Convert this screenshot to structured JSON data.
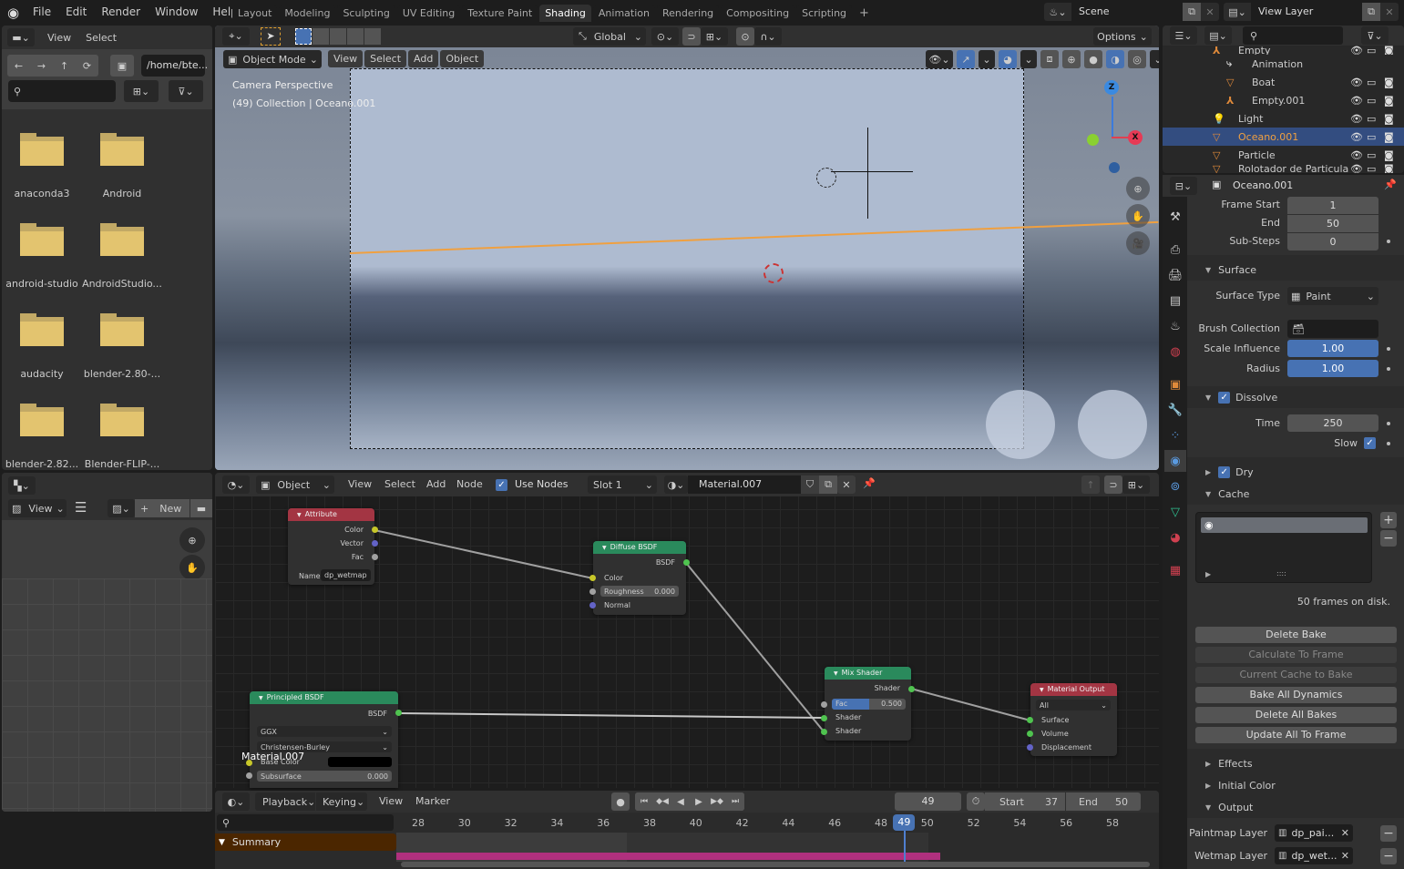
{
  "topbar": {
    "menus": [
      "File",
      "Edit",
      "Render",
      "Window",
      "Help"
    ],
    "workspaces": [
      "Layout",
      "Modeling",
      "Sculpting",
      "UV Editing",
      "Texture Paint",
      "Shading",
      "Animation",
      "Rendering",
      "Compositing",
      "Scripting"
    ],
    "active_workspace": "Shading",
    "add_tab": "+",
    "scene": "Scene",
    "view_layer": "View Layer"
  },
  "filebrowser": {
    "menus": [
      "View",
      "Select"
    ],
    "path": "/home/bte...",
    "search_placeholder": "",
    "folders": [
      "anaconda3",
      "Android",
      "android-studio",
      "AndroidStudio...",
      "audacity",
      "blender-2.80-...",
      "blender-2.82...",
      "Blender-FLIP-..."
    ]
  },
  "image_editor": {
    "view": "View",
    "new": "New"
  },
  "viewport": {
    "mode": "Object Mode",
    "menus": [
      "View",
      "Select",
      "Add",
      "Object"
    ],
    "orientation": "Global",
    "options": "Options",
    "overlay_line1": "Camera Perspective",
    "overlay_line2": "(49) Collection | Oceano.001",
    "gizmo": {
      "z": "Z",
      "x": "X"
    }
  },
  "outliner": {
    "rows": [
      {
        "name": "Empty",
        "type": "empty"
      },
      {
        "name": "Animation",
        "type": "action"
      },
      {
        "name": "Boat",
        "type": "mesh"
      },
      {
        "name": "Empty.001",
        "type": "empty"
      },
      {
        "name": "Light",
        "type": "light"
      },
      {
        "name": "Oceano.001",
        "type": "mesh",
        "selected": true
      },
      {
        "name": "Particle",
        "type": "mesh"
      },
      {
        "name": "Rolotador de Particula",
        "type": "mesh"
      }
    ]
  },
  "properties": {
    "object_name": "Oceano.001",
    "frame_start_label": "Frame Start",
    "frame_start": "1",
    "end_label": "End",
    "end": "50",
    "substeps_label": "Sub-Steps",
    "substeps": "0",
    "surface_section": "Surface",
    "surface_type_label": "Surface Type",
    "surface_type": "Paint",
    "brush_collection_label": "Brush Collection",
    "scale_influence_label": "Scale Influence",
    "scale_influence": "1.00",
    "radius_label": "Radius",
    "radius": "1.00",
    "dissolve_section": "Dissolve",
    "time_label": "Time",
    "time": "250",
    "slow_label": "Slow",
    "dry_section": "Dry",
    "cache_section": "Cache",
    "cache_status": "50 frames on disk.",
    "buttons": [
      {
        "label": "Delete Bake",
        "enabled": true
      },
      {
        "label": "Calculate To Frame",
        "enabled": false
      },
      {
        "label": "Current Cache to Bake",
        "enabled": false
      },
      {
        "label": "Bake All Dynamics",
        "enabled": true
      },
      {
        "label": "Delete All Bakes",
        "enabled": true
      },
      {
        "label": "Update All To Frame",
        "enabled": true
      }
    ],
    "effects_section": "Effects",
    "initial_color_section": "Initial Color",
    "output_section": "Output",
    "paintmap_label": "Paintmap Layer",
    "paintmap_value": "dp_pai...",
    "wetmap_label": "Wetmap Layer",
    "wetmap_value": "dp_wet..."
  },
  "node_editor": {
    "object": "Object",
    "menus": [
      "View",
      "Select",
      "Add",
      "Node"
    ],
    "use_nodes": "Use Nodes",
    "slot": "Slot 1",
    "material": "Material.007",
    "material_label": "Material.007",
    "nodes": {
      "attribute": {
        "title": "Attribute",
        "outputs": [
          "Color",
          "Vector",
          "Fac"
        ],
        "name_label": "Name:",
        "name_value": "dp_wetmap"
      },
      "diffuse": {
        "title": "Diffuse BSDF",
        "output": "BSDF",
        "color": "Color",
        "roughness_label": "Roughness",
        "roughness": "0.000",
        "normal": "Normal"
      },
      "principled": {
        "title": "Principled BSDF",
        "output": "BSDF",
        "distribution": "GGX",
        "subsurface_method": "Christensen-Burley",
        "base_color": "Base Color",
        "subsurface_label": "Subsurface",
        "subsurface": "0.000"
      },
      "mix": {
        "title": "Mix Shader",
        "output": "Shader",
        "fac_label": "Fac",
        "fac": "0.500",
        "fac_value": 0.5,
        "shader1": "Shader",
        "shader2": "Shader"
      },
      "output": {
        "title": "Material Output",
        "target": "All",
        "surface": "Surface",
        "volume": "Volume",
        "displacement": "Displacement"
      }
    }
  },
  "timeline": {
    "menus": [
      "Playback",
      "Keying",
      "View",
      "Marker"
    ],
    "current_frame": "49",
    "start_label": "Start",
    "start": "37",
    "end_label": "End",
    "end": "50",
    "ticks": [
      "28",
      "30",
      "32",
      "34",
      "36",
      "38",
      "40",
      "42",
      "44",
      "46",
      "48",
      "49",
      "50",
      "52",
      "54",
      "56",
      "58"
    ],
    "summary": "Summary"
  }
}
